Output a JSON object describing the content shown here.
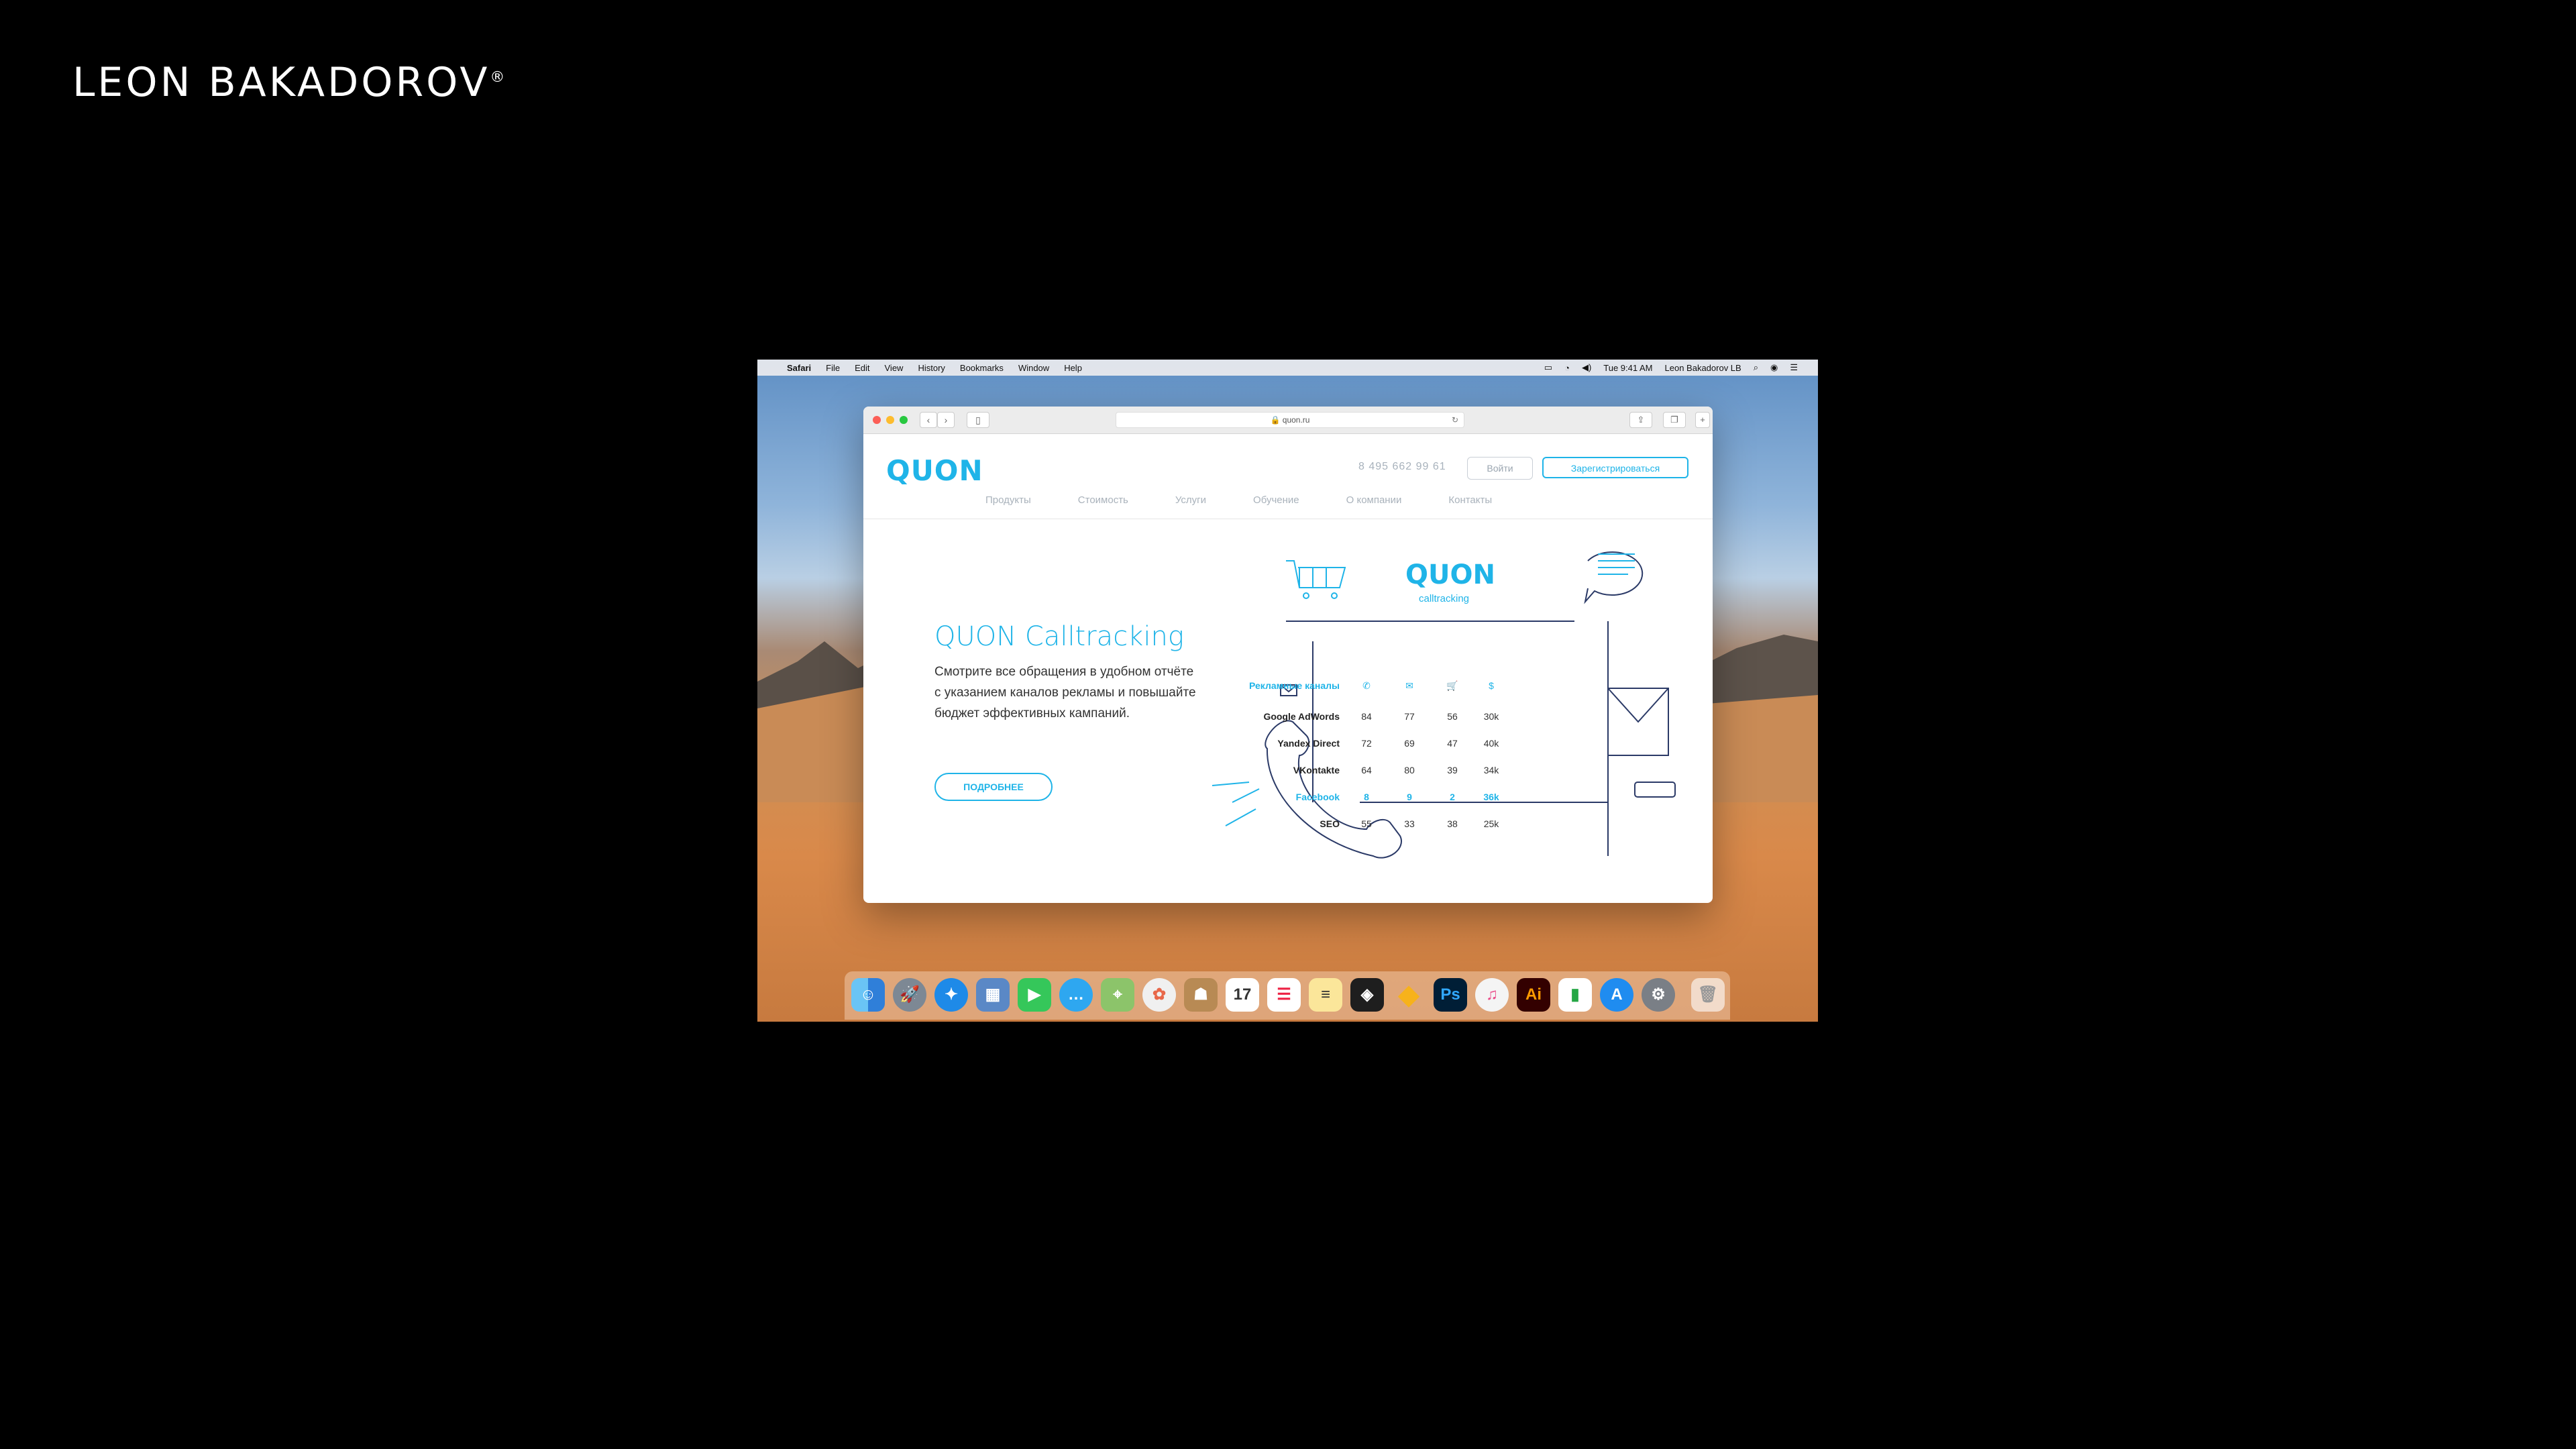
{
  "brand": {
    "name": "LEON BAKADOROV",
    "mark": "®"
  },
  "menubar": {
    "apple_icon": "apple-logo-icon",
    "items": [
      "Safari",
      "File",
      "Edit",
      "View",
      "History",
      "Bookmarks",
      "Window",
      "Help"
    ],
    "clock": "Tue 9:41 AM",
    "user": "Leon Bakadorov LB"
  },
  "browser": {
    "url": "quon.ru",
    "back": "‹",
    "forward": "›"
  },
  "site": {
    "logo": "QUON",
    "phone": "8 495 662 99 61",
    "login": "Войти",
    "register": "Зарегистрироваться",
    "nav": [
      "Продукты",
      "Стоимость",
      "Услуги",
      "Обучение",
      "О компании",
      "Контакты"
    ],
    "hero": {
      "title": "QUON Calltracking",
      "text": "Смотрите все обращения в удобном отчёте с указанием каналов рекламы и повышайте бюджет эффективных кампаний.",
      "button": "ПОДРОБНЕЕ"
    },
    "illustration": {
      "logo": "QUON",
      "sub": "calltracking",
      "table": {
        "header": "Рекламные каналы",
        "rows": [
          {
            "name": "Google AdWords",
            "values": [
              "84",
              "77",
              "56",
              "30k"
            ],
            "highlight": false
          },
          {
            "name": "Yandex Direct",
            "values": [
              "72",
              "69",
              "47",
              "40k"
            ],
            "highlight": false
          },
          {
            "name": "VKontakte",
            "values": [
              "64",
              "80",
              "39",
              "34k"
            ],
            "highlight": false
          },
          {
            "name": "Facebook",
            "values": [
              "8",
              "9",
              "2",
              "36k"
            ],
            "highlight": true
          },
          {
            "name": "SEO",
            "values": [
              "55",
              "33",
              "38",
              "25k"
            ],
            "highlight": false
          }
        ]
      }
    }
  },
  "dock": {
    "apps": [
      "finder",
      "launchpad",
      "safari",
      "preview",
      "facetime",
      "messages",
      "maps",
      "photos",
      "contacts",
      "calendar",
      "reminders",
      "notes",
      "figma",
      "sketch",
      "photoshop",
      "itunes",
      "illustrator",
      "numbers",
      "app-store",
      "system-preferences",
      "trash"
    ],
    "calendar_day": "17",
    "ps_label": "Ps",
    "ai_label": "Ai"
  }
}
